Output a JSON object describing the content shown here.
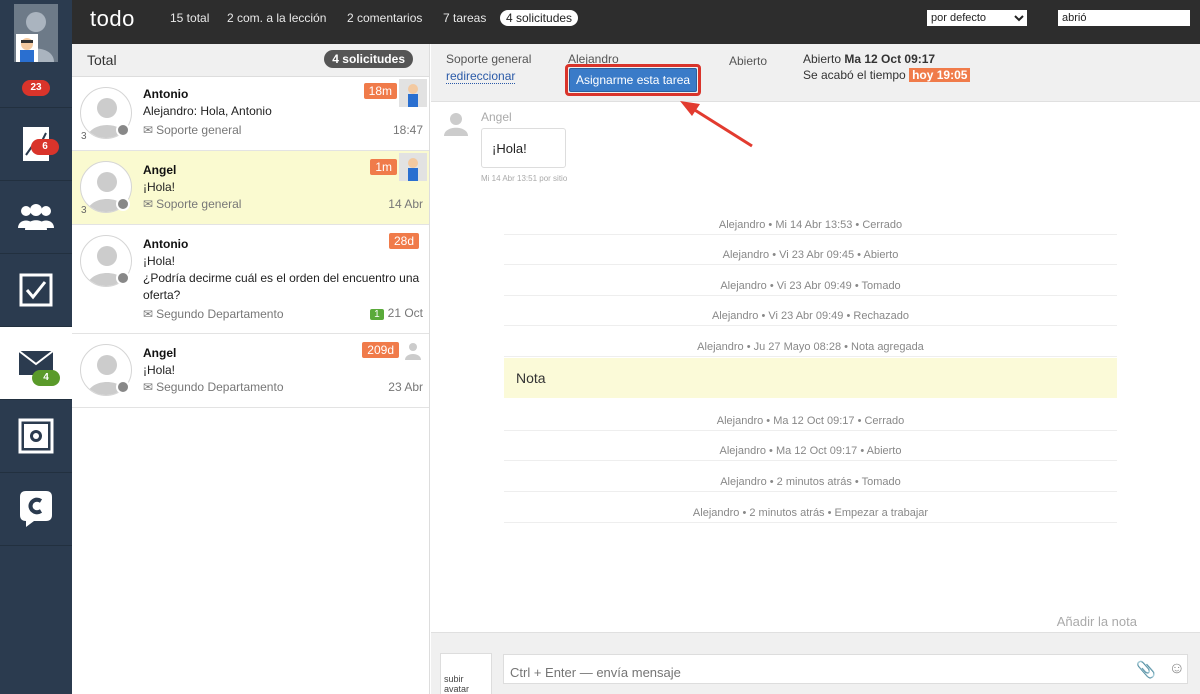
{
  "rail": {
    "items": [
      {
        "name": "user-avatar",
        "badge": "23",
        "badge_color": "#d9342b"
      },
      {
        "name": "stats-icon",
        "badge": "6",
        "badge_color": "#d9342b"
      },
      {
        "name": "users-icon"
      },
      {
        "name": "tasks-icon"
      },
      {
        "name": "mail-icon",
        "badge": "4",
        "badge_color": "#5a9a2a",
        "active": true
      },
      {
        "name": "settings-icon"
      },
      {
        "name": "chat-logo-icon"
      }
    ]
  },
  "topbar": {
    "title": "todo",
    "tabs": [
      "15 total",
      "2 com. a la lección",
      "2 comentarios",
      "7 tareas",
      "4 solicitudes"
    ],
    "sort_selected": "por defecto",
    "filter_value": "abrió"
  },
  "list": {
    "header_label": "Total",
    "header_count": "4 solicitudes",
    "items": [
      {
        "name": "Antonio",
        "num": "3",
        "lines": [
          "Alejandro: Hola, Antonio"
        ],
        "dept": "Soporte general",
        "time": "18:47",
        "age": "18m"
      },
      {
        "name": "Angel",
        "num": "3",
        "lines": [
          "¡Hola!"
        ],
        "dept": "Soporte general",
        "time": "14 Abr",
        "age": "1m"
      },
      {
        "name": "Antonio",
        "lines": [
          "¡Hola!",
          "¿Podría decirme cuál es el orden del encuentro una",
          "oferta?"
        ],
        "dept": "Segundo Departamento",
        "time": "21 Oct",
        "age": "28d",
        "count": "1"
      },
      {
        "name": "Angel",
        "lines": [
          "¡Hola!"
        ],
        "dept": "Segundo Departamento",
        "time": "23 Abr",
        "age": "209d"
      }
    ]
  },
  "detail": {
    "department": "Soporte general",
    "redirect_link": "redireccionar",
    "assignee": "Alejandro",
    "assign_button": "Asignarme esta tarea",
    "status": "Abierto",
    "opened_prefix": "Abierto",
    "opened_date": "Ma 12 Oct 09:17",
    "deadline_prefix": "Se acabó el tiempo",
    "deadline_value": "hoy 19:05",
    "message": {
      "author": "Angel",
      "text": "¡Hola!",
      "meta": "Mi 14 Abr 13:51 por sitio"
    },
    "events": [
      "Alejandro • Mi 14 Abr 13:53 • Cerrado",
      "Alejandro • Vi 23 Abr 09:45 • Abierto",
      "Alejandro • Vi 23 Abr 09:49 • Tomado",
      "Alejandro • Vi 23 Abr 09:49 • Rechazado",
      "Alejandro • Ju 27 Mayo 08:28 • Nota agregada",
      "Alejandro • Ma 12 Oct 09:17 • Cerrado",
      "Alejandro • Ma 12 Oct 09:17 • Abierto",
      "Alejandro • 2 minutos atrás • Tomado",
      "Alejandro • 2 minutos atrás • Empezar a trabajar"
    ],
    "note_text": "Nota",
    "add_note": "Añadir la nota",
    "composer_placeholder": "Ctrl + Enter — envía mensaje",
    "upload_avatar": "subir avatar"
  }
}
